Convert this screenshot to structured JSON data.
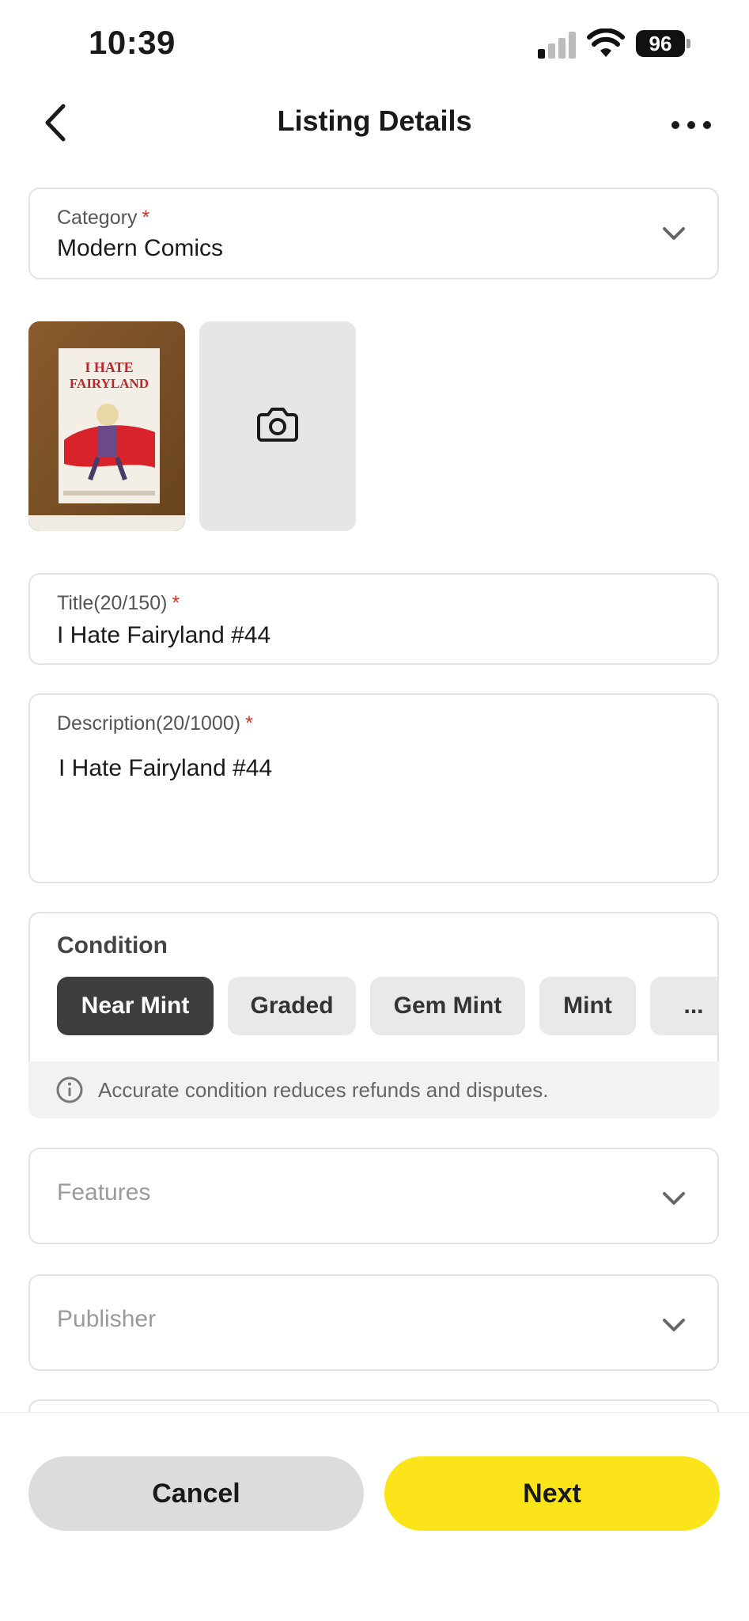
{
  "status": {
    "time": "10:39",
    "battery": "96"
  },
  "header": {
    "title": "Listing Details"
  },
  "category": {
    "label": "Category",
    "required": "*",
    "value": "Modern Comics"
  },
  "photos": {
    "thumb_icon": "comic-cover-photo",
    "add_icon": "camera-icon"
  },
  "title_field": {
    "label": "Title(20/150)",
    "required": "*",
    "value": "I Hate Fairyland #44"
  },
  "description_field": {
    "label": "Description(20/1000)",
    "required": "*",
    "value": "I Hate Fairyland #44"
  },
  "condition": {
    "title": "Condition",
    "options": [
      "Near Mint",
      "Graded",
      "Gem Mint",
      "Mint",
      "..."
    ],
    "selected": "Near Mint",
    "info": "Accurate condition reduces refunds and disputes."
  },
  "features": {
    "placeholder": "Features"
  },
  "publisher": {
    "placeholder": "Publisher"
  },
  "actions": {
    "cancel": "Cancel",
    "next": "Next"
  },
  "colors": {
    "accent": "#fbe41a",
    "selected_chip": "#3d3d3d",
    "required": "#d0342c"
  }
}
